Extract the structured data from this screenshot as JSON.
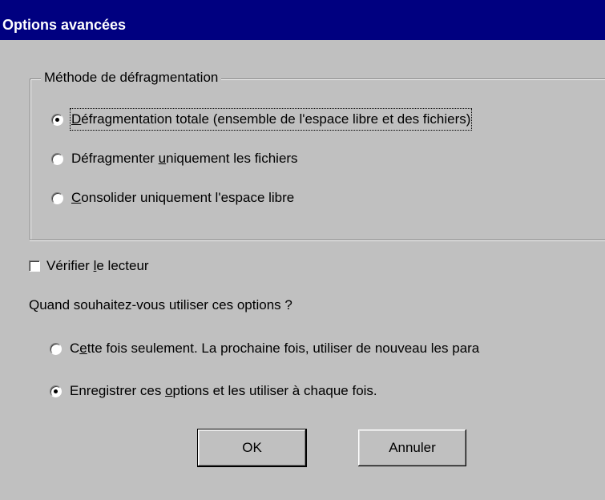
{
  "dialog": {
    "title": "Options avancées"
  },
  "method_group": {
    "legend": "Méthode de défragmentation",
    "options": [
      {
        "pre": "",
        "mnemonic": "D",
        "post": "éfragmentation totale (ensemble de l'espace libre et des fichiers)",
        "selected": true
      },
      {
        "pre": "Défragmenter ",
        "mnemonic": "u",
        "post": "niquement les fichiers",
        "selected": false
      },
      {
        "pre": "",
        "mnemonic": "C",
        "post": "onsolider uniquement l'espace libre",
        "selected": false
      }
    ]
  },
  "check_drive": {
    "pre": "Vérifier ",
    "mnemonic": "l",
    "post": "e lecteur",
    "checked": false
  },
  "when": {
    "question": "Quand souhaitez-vous utiliser ces options ?",
    "options": [
      {
        "pre": "C",
        "mnemonic": "e",
        "post": "tte fois seulement. La prochaine fois, utiliser de nouveau les para",
        "selected": false
      },
      {
        "pre": "Enregistrer ces ",
        "mnemonic": "o",
        "post": "ptions et les utiliser à chaque fois.",
        "selected": true
      }
    ]
  },
  "buttons": {
    "ok": "OK",
    "cancel": "Annuler"
  }
}
